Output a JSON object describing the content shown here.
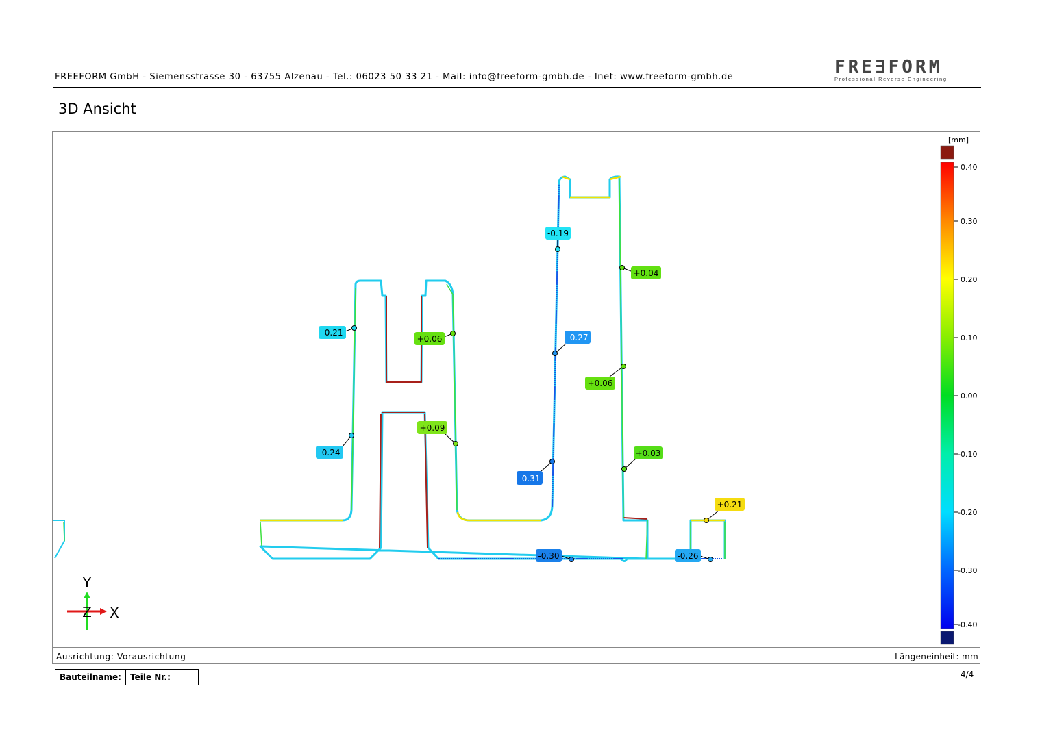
{
  "header": {
    "company_line": "FREEFORM GmbH - Siemensstrasse 30 - 63755 Alzenau - Tel.: 06023 50 33 21 - Mail: info@freeform-gmbh.de - Inet: www.freeform-gmbh.de",
    "logo_text": "FRE∃FORM",
    "logo_subtitle": "Professional Reverse Engineering"
  },
  "section_title": "3D Ansicht",
  "deviation_labels": [
    {
      "text": "-0.19",
      "color": "#22e3f5"
    },
    {
      "text": "+0.04",
      "color": "#62e012"
    },
    {
      "text": "-0.21",
      "color": "#20d8f0"
    },
    {
      "text": "+0.06",
      "color": "#66e010"
    },
    {
      "text": "-0.27",
      "color": "#2196f3"
    },
    {
      "text": "+0.06",
      "color": "#66e010"
    },
    {
      "text": "+0.09",
      "color": "#7fe41a"
    },
    {
      "text": "-0.24",
      "color": "#22c8f2"
    },
    {
      "text": "+0.03",
      "color": "#55dd18"
    },
    {
      "text": "-0.31",
      "color": "#1677e8"
    },
    {
      "text": "+0.21",
      "color": "#f5dc10"
    },
    {
      "text": "-0.30",
      "color": "#1a80ea"
    },
    {
      "text": "-0.26",
      "color": "#24a8f2"
    }
  ],
  "legend": {
    "unit": "[mm]",
    "ticks": [
      "0.40",
      "0.30",
      "0.20",
      "0.10",
      "0.00",
      "-0.10",
      "-0.20",
      "-0.30",
      "-0.40"
    ],
    "over_color": "#8b1a10",
    "under_color": "#0a1870"
  },
  "axes_triad": {
    "y": "Y",
    "z": "Z",
    "x": "X"
  },
  "footer": {
    "alignment": "Ausrichtung: Vorausrichtung",
    "unit": "Längeneinheit: mm"
  },
  "parts_table": {
    "name_label": "Bauteilname:",
    "number_label": "Teile Nr.:"
  },
  "page": "4/4"
}
